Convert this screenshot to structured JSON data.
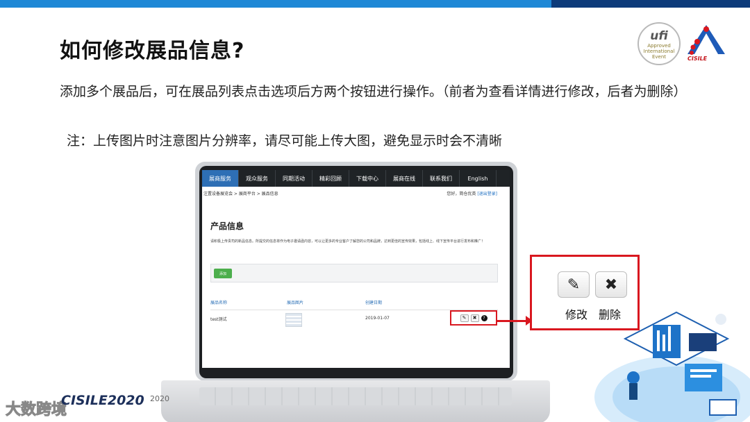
{
  "slide": {
    "title": "如何修改展品信息?",
    "body": "添加多个展品后，可在展品列表点击选项后方两个按钮进行操作。（前者为查看详情进行修改，后者为删除）",
    "note": "注：上传图片时注意图片分辨率，请尽可能上传大图，避免显示时会不清晰"
  },
  "logos": {
    "ufi": {
      "mark": "ufi",
      "line1": "Approved",
      "line2": "International",
      "line3": "Event"
    },
    "cisile": {
      "caption": "CISILE"
    }
  },
  "site": {
    "nav": [
      "展商服务",
      "观众服务",
      "同期活动",
      "精彩回顾",
      "下载中心",
      "展商在线",
      "联系我们",
      "English"
    ],
    "active_nav": "展商服务",
    "breadcrumb": "注置设备展览会 > 展商平台 > 展品信息",
    "greeting": "您好，简仓优英",
    "logout": "[退出登录]",
    "heading": "产品信息",
    "description": "请积极上传贵司的新品信息。所提交的信息将作为电子邀请函内容，可以让更多的专业客户了解您的公司和品牌，达到更佳的宣传效果，包括线上、线下宣传平台进行发布和推广！",
    "add_button": "添加",
    "table": {
      "headers": [
        "展品名称",
        "展品图片",
        "创建日期"
      ],
      "rows": [
        {
          "name": "test测试",
          "date": "2019-01-07"
        }
      ]
    }
  },
  "callout": {
    "edit_label": "修改",
    "delete_label": "删除"
  },
  "footer": {
    "brand": "CISILE2020",
    "year": "2020",
    "watermark": "大数跨境"
  },
  "colors": {
    "top_bar": "#1e88d6",
    "top_bar_dark": "#0d3b7a",
    "highlight_red": "#d9171f",
    "nav_active": "#2e6fb5",
    "add_green": "#4cae4c"
  },
  "icons": {
    "edit": "edit-icon",
    "delete": "close-icon",
    "help": "question-icon"
  }
}
